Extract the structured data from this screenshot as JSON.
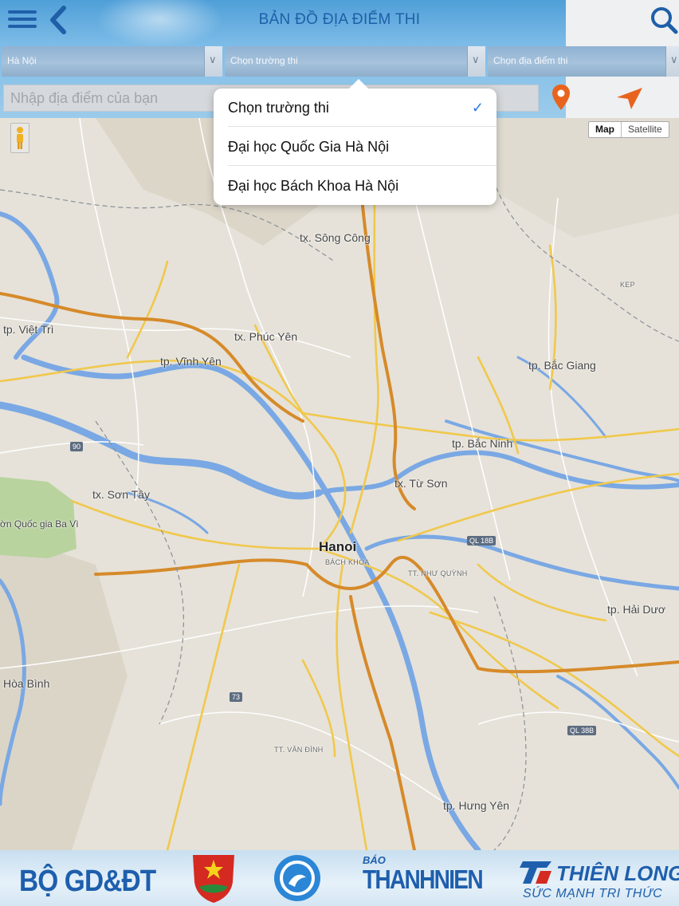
{
  "header": {
    "title": "BẢN ĐỒ ĐỊA ĐIỂM THI",
    "menu_icon": "hamburger-menu-icon",
    "back_icon": "chevron-left-icon",
    "search_icon": "search-icon"
  },
  "filters": {
    "city": "Hà Nội",
    "school": "Chọn trường thi",
    "location": "Chọn địa điểm thi"
  },
  "location_input": {
    "placeholder": "Nhập địa điểm của bạn",
    "value": ""
  },
  "school_dropdown": {
    "options": [
      {
        "label": "Chọn trường thi",
        "selected": true
      },
      {
        "label": "Đại học Quốc Gia Hà Nội",
        "selected": false
      },
      {
        "label": "Đại học Bách Khoa Hà Nội",
        "selected": false
      }
    ],
    "check_glyph": "✓"
  },
  "map": {
    "type_buttons": {
      "map": "Map",
      "satellite": "Satellite"
    },
    "active_type": "Map",
    "labels": {
      "song_cong": "tx. Sông Công",
      "kep": "KEP",
      "viet_tri": "tp. Việt Trì",
      "phuc_yen": "tx. Phúc Yên",
      "vinh_yen": "tp. Vĩnh Yên",
      "bac_giang": "tp. Bắc Giang",
      "bac_ninh": "tp. Bắc Ninh",
      "tu_son": "tx. Từ Sơn",
      "son_tay": "tx. Sơn Tây",
      "ba_vi": "ờn Quốc gia Ba Vì",
      "hanoi": "Hanoi",
      "bach_khoa": "BÁCH KHOA",
      "nhu_quynh": "TT. NHƯ QUỲNH",
      "hai_duong": "tp. Hải Dươ",
      "hoa_binh": "Hòa Bình",
      "van_dinh": "TT. VÂN ĐÌNH",
      "hung_yen": "tp. Hưng Yên"
    },
    "shields": {
      "r90": "90",
      "r73": "73",
      "ql18b": "QL 18B",
      "ql38b": "QL 38B"
    }
  },
  "footer": {
    "moet": "BỘ GD&ĐT",
    "thanh_nien_small": "BÁO",
    "thanh_nien_big": "THANHNIEN",
    "thien_long": "THIÊN LONG",
    "thien_long_slogan": "SỨC MẠNH TRI THỨC"
  },
  "colors": {
    "accent": "#1f5fa8",
    "pin": "#e8641e",
    "check": "#2a7ae2",
    "highway": "#d68a2a",
    "road": "#f0c84c",
    "water": "#7aa8e4"
  }
}
